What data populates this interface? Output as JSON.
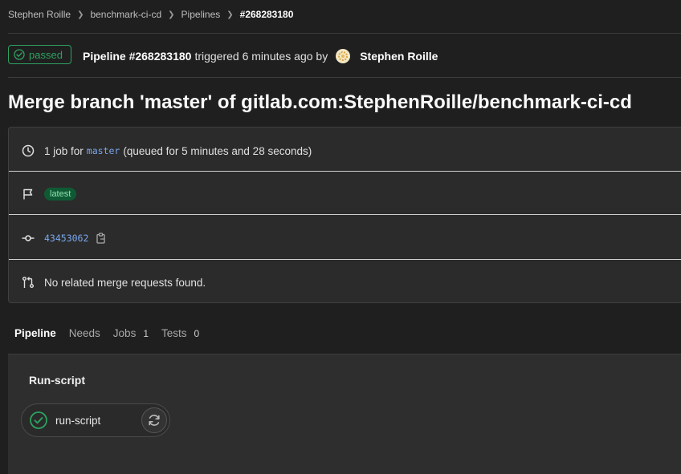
{
  "breadcrumb": [
    "Stephen Roille",
    "benchmark-ci-cd",
    "Pipelines",
    "#268283180"
  ],
  "status": {
    "label": "passed",
    "color": "#2da160",
    "icon": "check-circle-icon"
  },
  "header": {
    "pipeline": "Pipeline #268283180",
    "triggered": "triggered 6 minutes ago by",
    "user": "Stephen Roille"
  },
  "title": "Merge branch 'master' of gitlab.com:StephenRoille/benchmark-ci-cd",
  "info": {
    "jobs_prefix": "1 job for",
    "branch": "master",
    "queued": "(queued for 5 minutes and 28 seconds)",
    "tag": "latest",
    "commit": "43453062",
    "merge_requests": "No related merge requests found."
  },
  "tabs": [
    {
      "label": "Pipeline",
      "count": ""
    },
    {
      "label": "Needs",
      "count": ""
    },
    {
      "label": "Jobs",
      "count": "1"
    },
    {
      "label": "Tests",
      "count": "0"
    }
  ],
  "stage": {
    "title": "Run-script",
    "job": {
      "name": "run-script",
      "status_icon": "check-circle-icon",
      "action_icon": "retry-icon"
    }
  }
}
